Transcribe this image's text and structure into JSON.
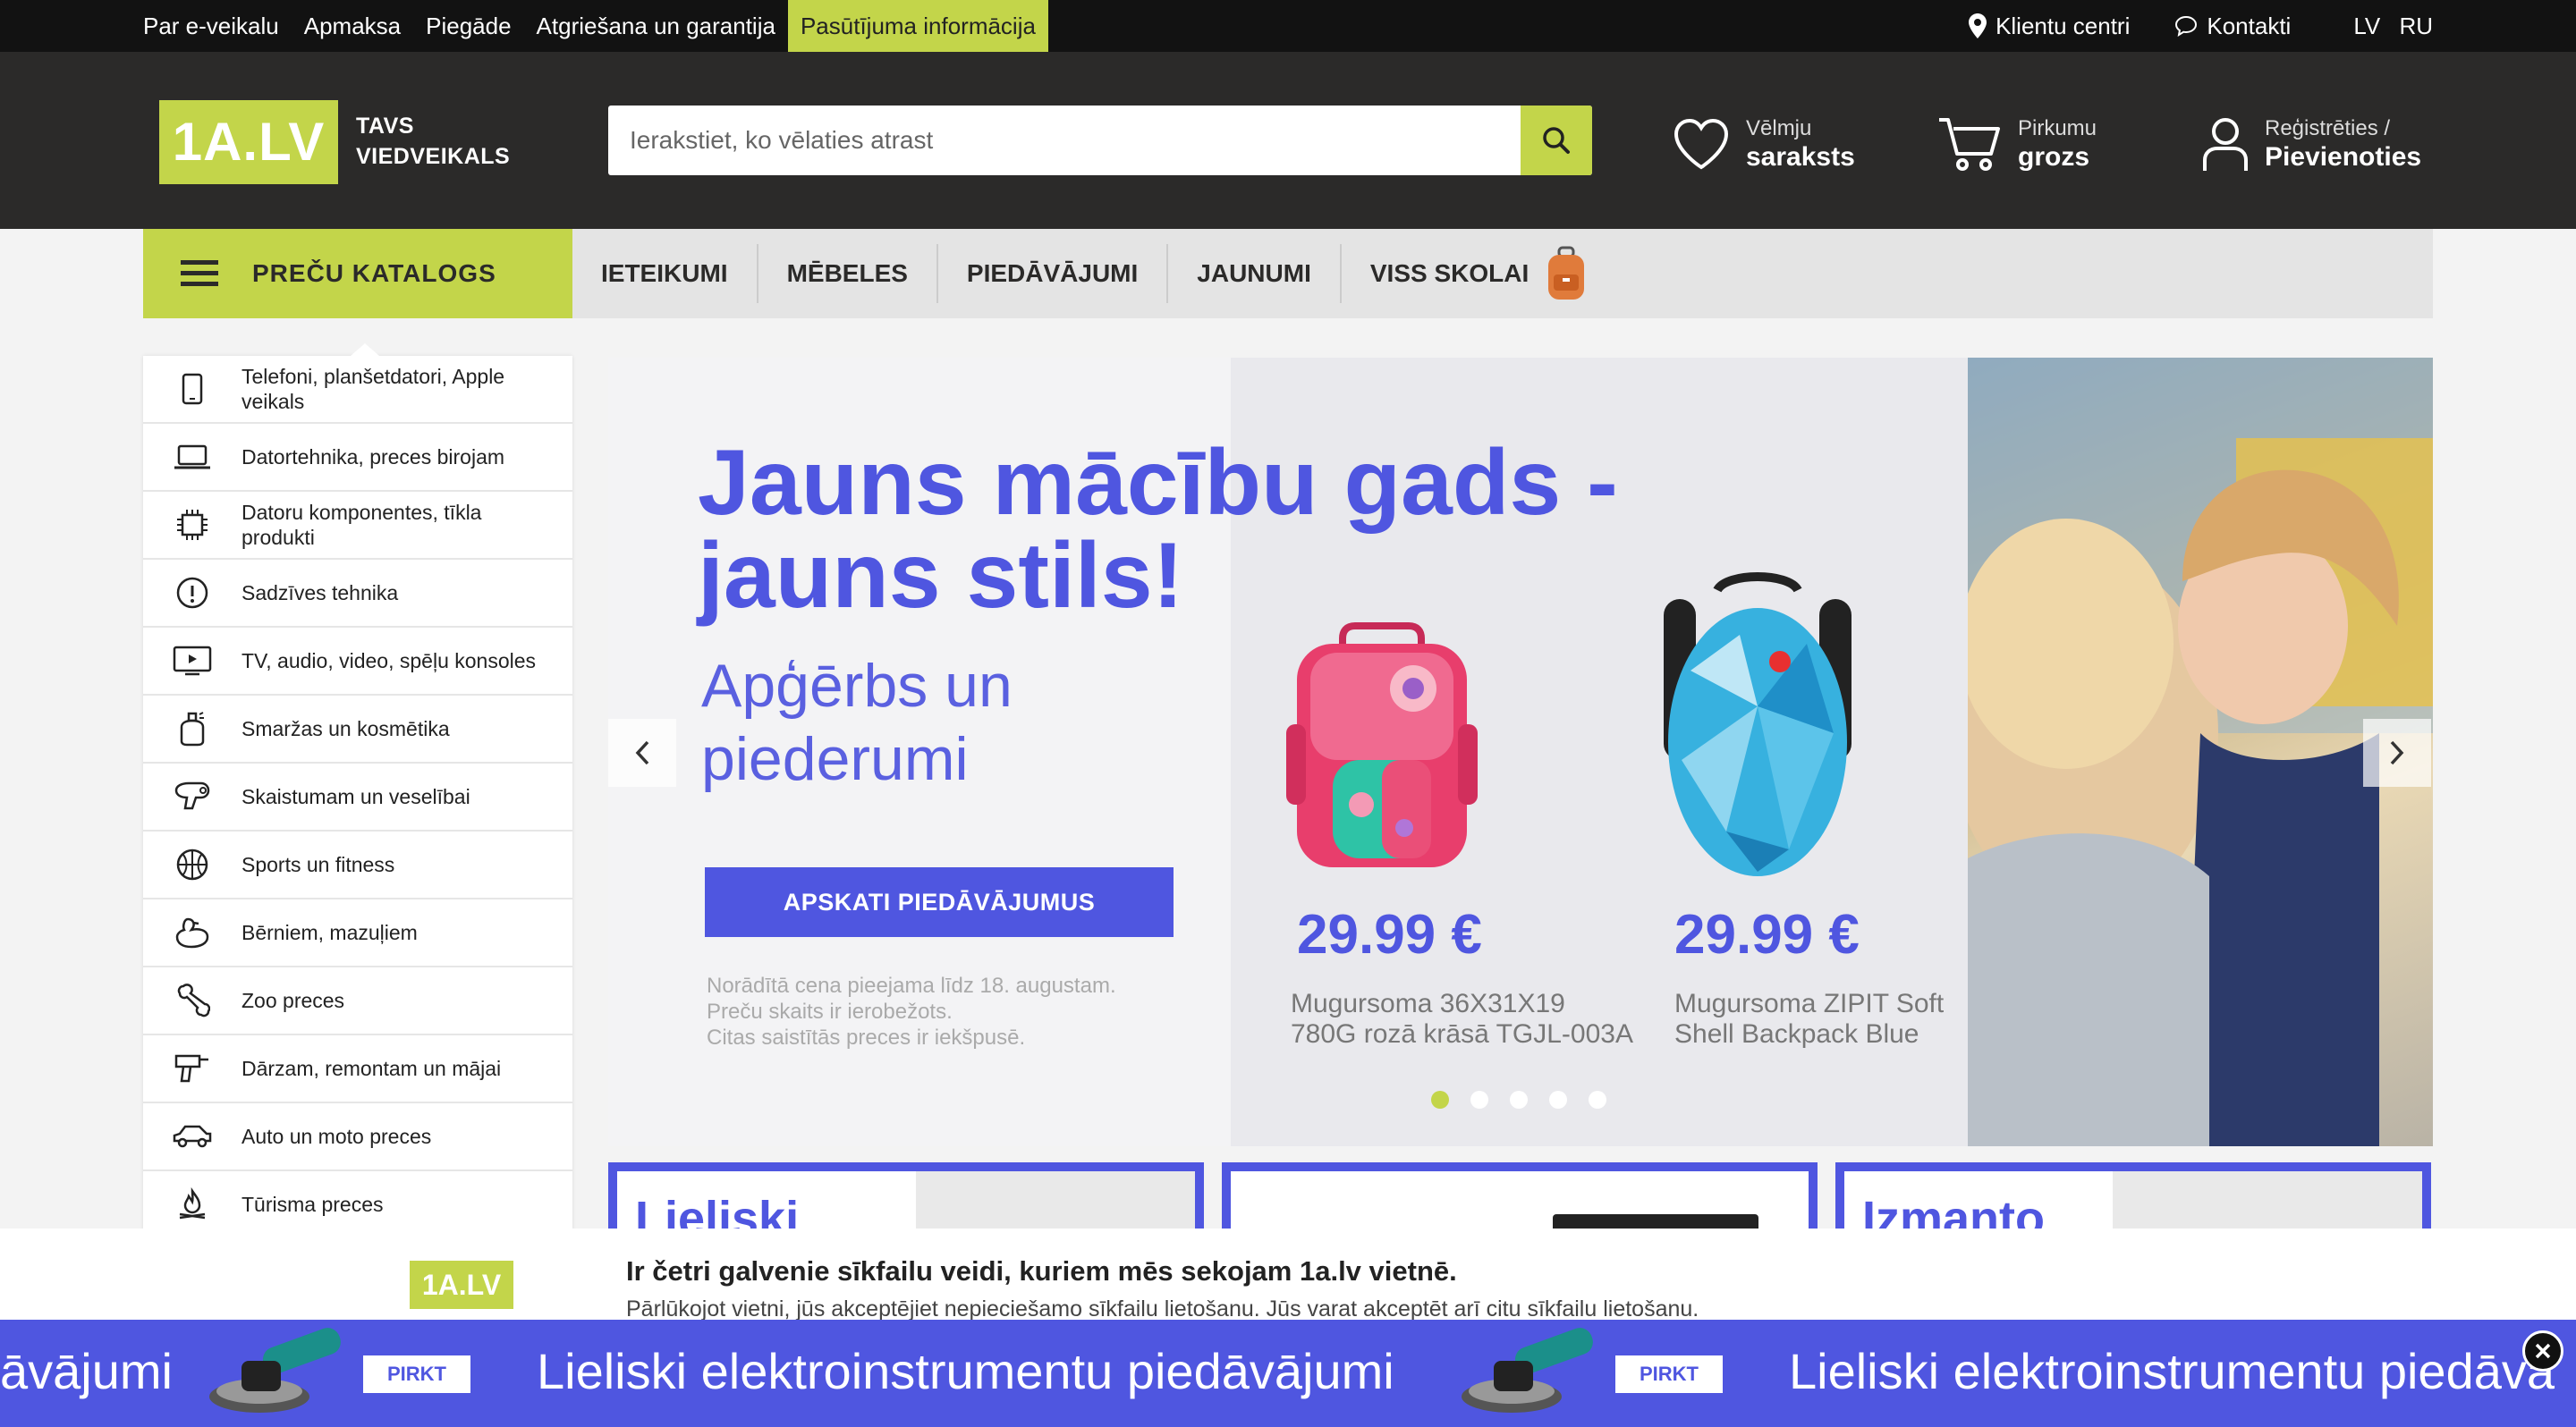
{
  "topbar": {
    "links": [
      "Par e-veikalu",
      "Apmaksa",
      "Piegāde",
      "Atgriešana un garantija",
      "Pasūtījuma informācija"
    ],
    "client_centre": "Klientu centri",
    "contacts": "Kontakti",
    "lang_lv": "LV",
    "lang_ru": "RU"
  },
  "header": {
    "logo": "1A.LV",
    "tagline_1": "TAVS",
    "tagline_2": "VIEDVEIKALS",
    "search_placeholder": "Ierakstiet, ko vēlaties atrast",
    "wishlist_1": "Vēlmju",
    "wishlist_2": "saraksts",
    "cart_1": "Pirkumu",
    "cart_2": "grozs",
    "account_1": "Reģistrēties /",
    "account_2": "Pievienoties"
  },
  "nav": {
    "catalog": "PREČU KATALOGS",
    "links": [
      "IETEIKUMI",
      "MĒBELES",
      "PIEDĀVĀJUMI",
      "JAUNUMI",
      "VISS SKOLAI"
    ]
  },
  "sidebar": {
    "items": [
      "Telefoni, planšetdatori, Apple veikals",
      "Datortehnika, preces birojam",
      "Datoru komponentes, tīkla produkti",
      "Sadzīves tehnika",
      "TV, audio, video, spēļu konsoles",
      "Smaržas un kosmētika",
      "Skaistumam un veselībai",
      "Sports un fitness",
      "Bērniem, mazuļiem",
      "Zoo preces",
      "Dārzam, remontam un mājai",
      "Auto un moto preces",
      "Tūrisma preces"
    ]
  },
  "banner": {
    "title_1": "Jauns mācību gads -",
    "title_2": "jauns stils!",
    "subtitle_1": "Apģērbs un",
    "subtitle_2": "piederumi",
    "button": "APSKATI PIEDĀVĀJUMUS",
    "note_1": "Norādītā cena pieejama līdz 18. augustam.",
    "note_2": "Preču skaits ir ierobežots.",
    "note_3": "Citas saistītās preces ir iekšpusē.",
    "product_1_price": "29.99 €",
    "product_1_name_1": "Mugursoma 36X31X19",
    "product_1_name_2": "780G rozā krāsā TGJL-003A",
    "product_2_price": "29.99 €",
    "product_2_name_1": "Mugursoma ZIPIT Soft",
    "product_2_name_2": "Shell Backpack Blue",
    "slides": 5,
    "active_slide": 1
  },
  "cards": {
    "card_1_title": "Lieliski",
    "card_3_title": "Izmanto"
  },
  "cookie": {
    "logo": "1A.LV",
    "title": "Ir četri galvenie sīkfailu veidi, kuriem mēs sekojam 1a.lv vietnē.",
    "text": "Pārlūkojot vietni, jūs akceptējiet nepieciešamo sīkfailu lietošanu. Jūs varat akceptēt arī citu sīkfailu lietošanu."
  },
  "promo": {
    "text_partial": "āvājumi",
    "text": "Lieliski elektroinstrumentu piedāvājumi",
    "text_cut": "Lieliski elektroinstrumentu piedāva",
    "button": "PIRKT"
  },
  "colors": {
    "accent": "#c3d54a",
    "dark": "#2b2a29",
    "brand_blue": "#4f56e0"
  }
}
